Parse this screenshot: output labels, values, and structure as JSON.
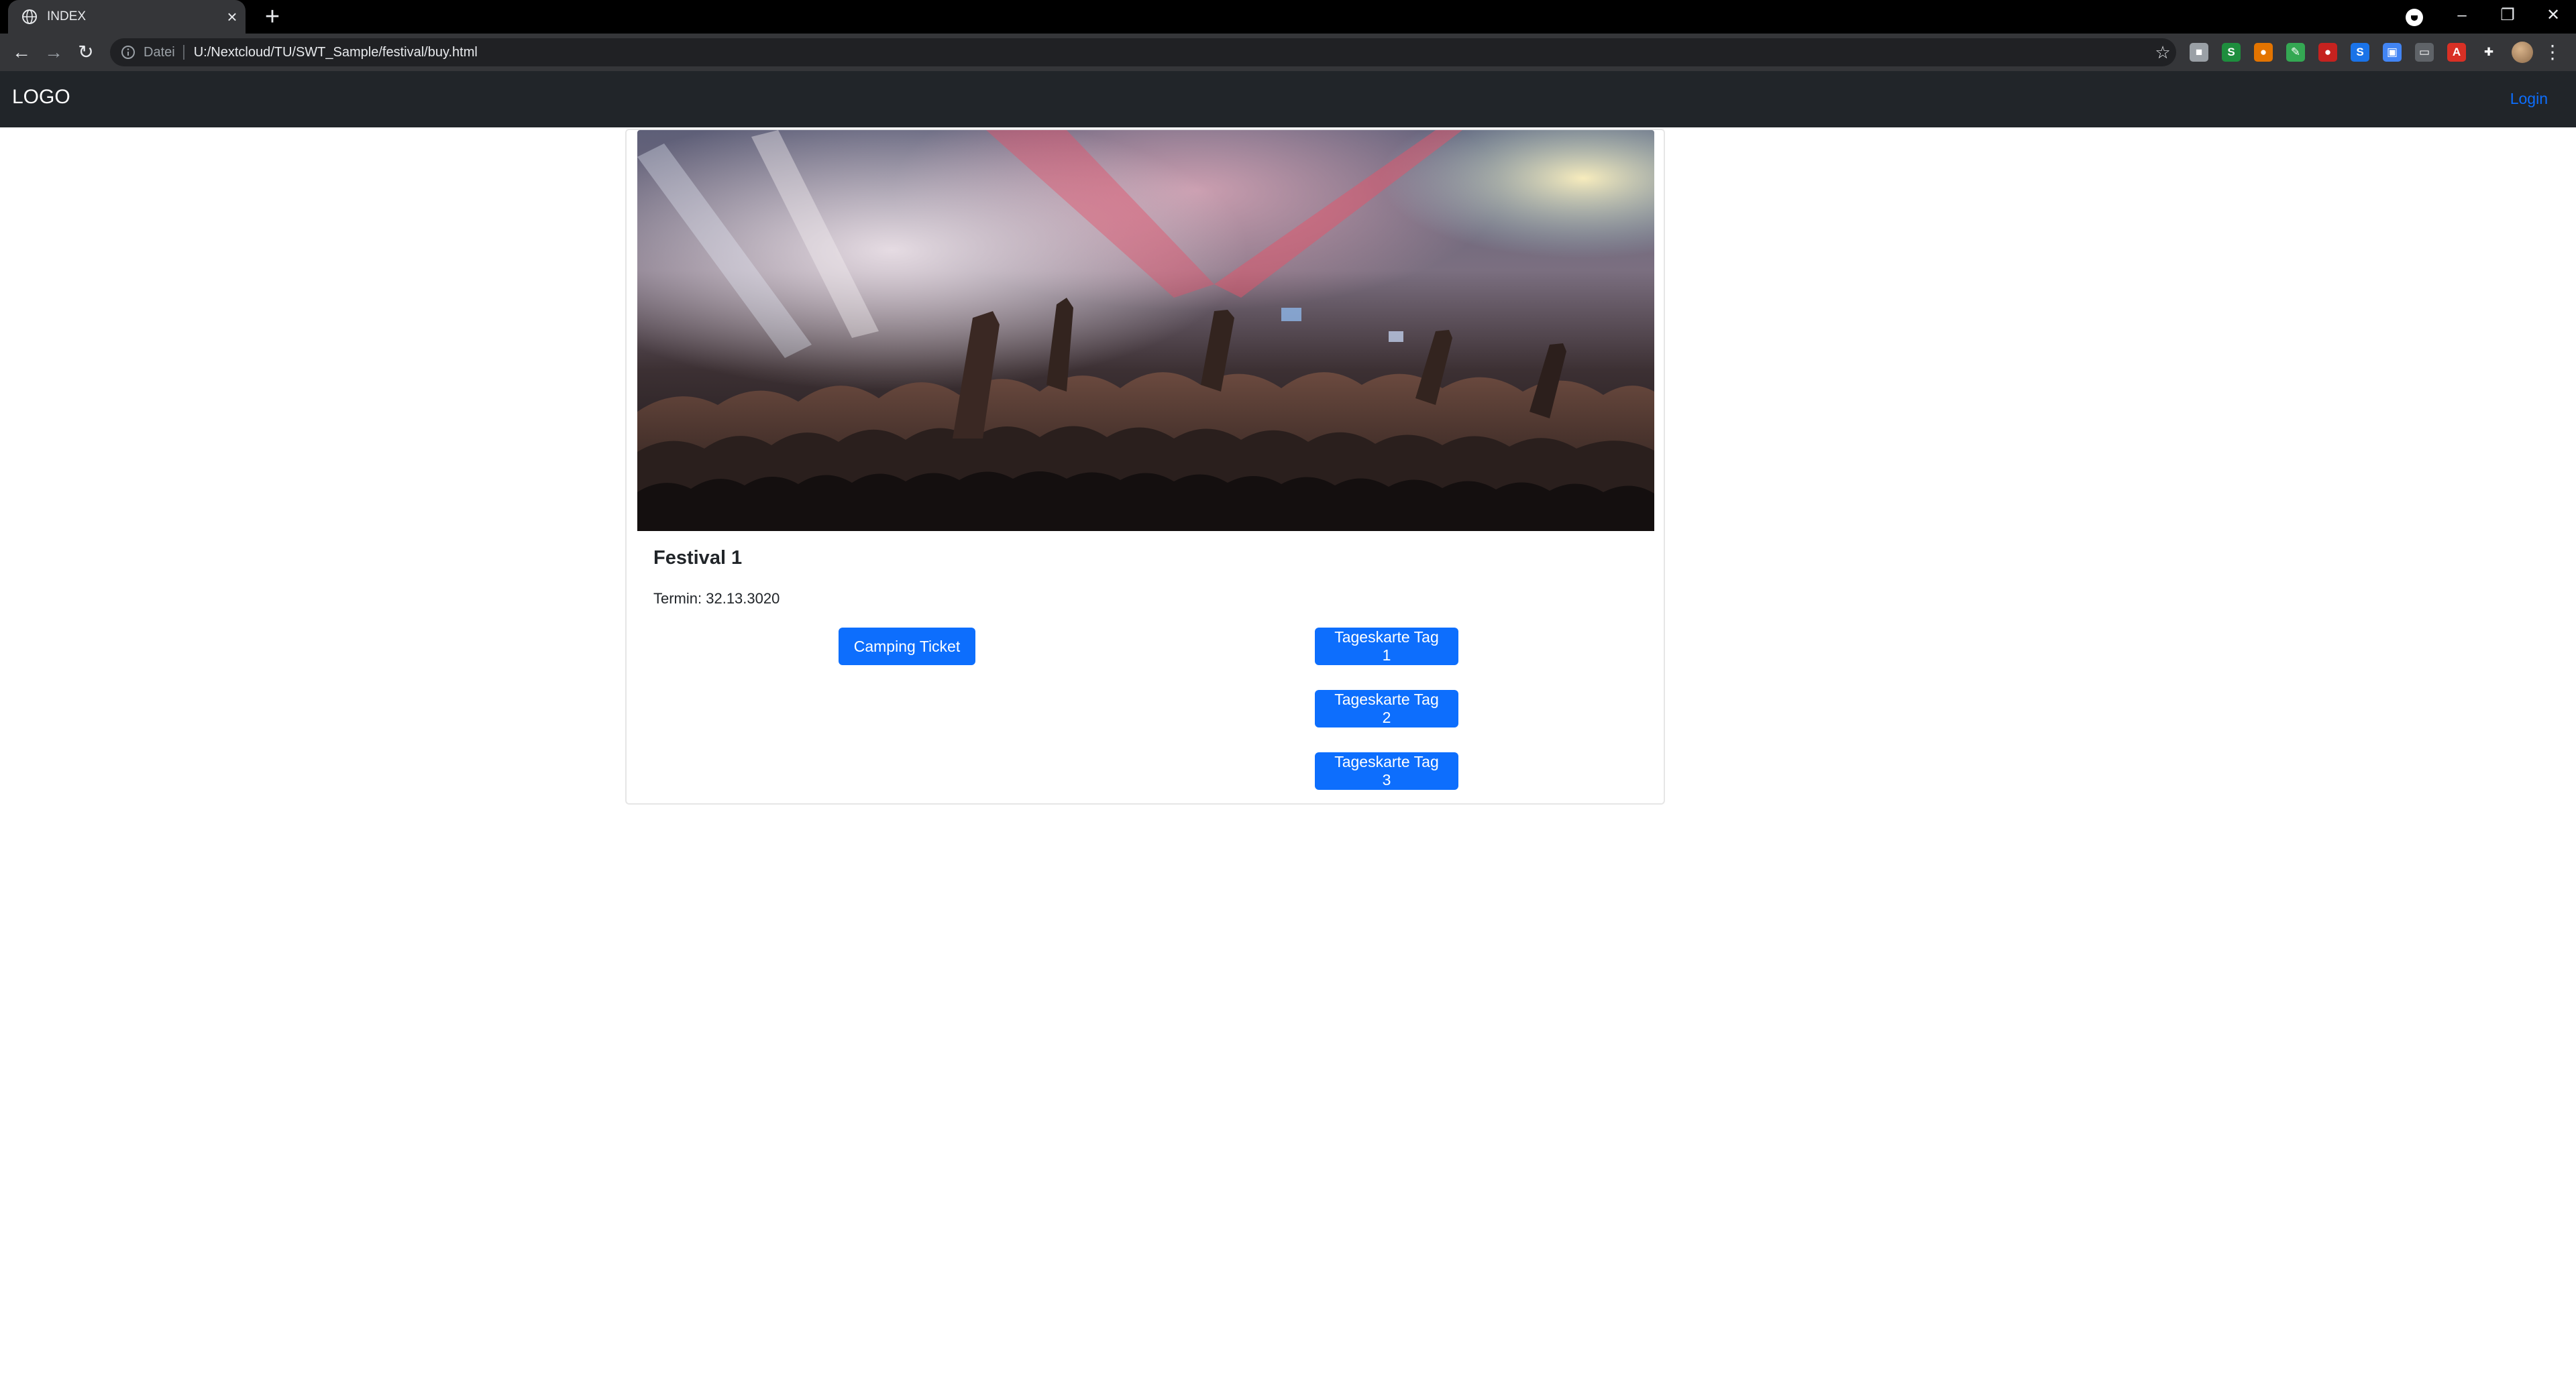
{
  "browser": {
    "tab_title": "INDEX",
    "tab_close": "×",
    "new_tab": "+",
    "url_scheme_label": "Datei",
    "url": "U:/Nextcloud/TU/SWT_Sample/festival/buy.html",
    "window_controls": [
      "–",
      "❐",
      "✕"
    ],
    "extensions": [
      {
        "name": "ext-gray",
        "color": "#9aa0a6",
        "glyph": "■"
      },
      {
        "name": "ext-s-green",
        "color": "#1e8e3e",
        "glyph": "S"
      },
      {
        "name": "ext-orange",
        "color": "#e37400",
        "glyph": "●"
      },
      {
        "name": "ext-pen",
        "color": "#34a853",
        "glyph": "✎"
      },
      {
        "name": "ext-red-oval",
        "color": "#c5221f",
        "glyph": "●"
      },
      {
        "name": "ext-s-blue",
        "color": "#1a73e8",
        "glyph": "S"
      },
      {
        "name": "ext-image",
        "color": "#4285f4",
        "glyph": "▣"
      },
      {
        "name": "ext-window",
        "color": "#5f6368",
        "glyph": "▭"
      },
      {
        "name": "ext-a-red",
        "color": "#d93025",
        "glyph": "A"
      },
      {
        "name": "ext-puzzle",
        "color": "#353639",
        "glyph": "✚"
      }
    ]
  },
  "navbar": {
    "brand": "LOGO",
    "login": "Login"
  },
  "card": {
    "title": "Festival 1",
    "date_text": "Termin: 32.13.3020",
    "buttons": {
      "camping": "Camping Ticket",
      "day1": "Tageskarte Tag 1",
      "day2": "Tageskarte Tag 2",
      "day3": "Tageskarte Tag 3"
    }
  },
  "colors": {
    "navbar_bg": "#212529",
    "primary": "#0d6efd",
    "link": "#0d6efd"
  }
}
